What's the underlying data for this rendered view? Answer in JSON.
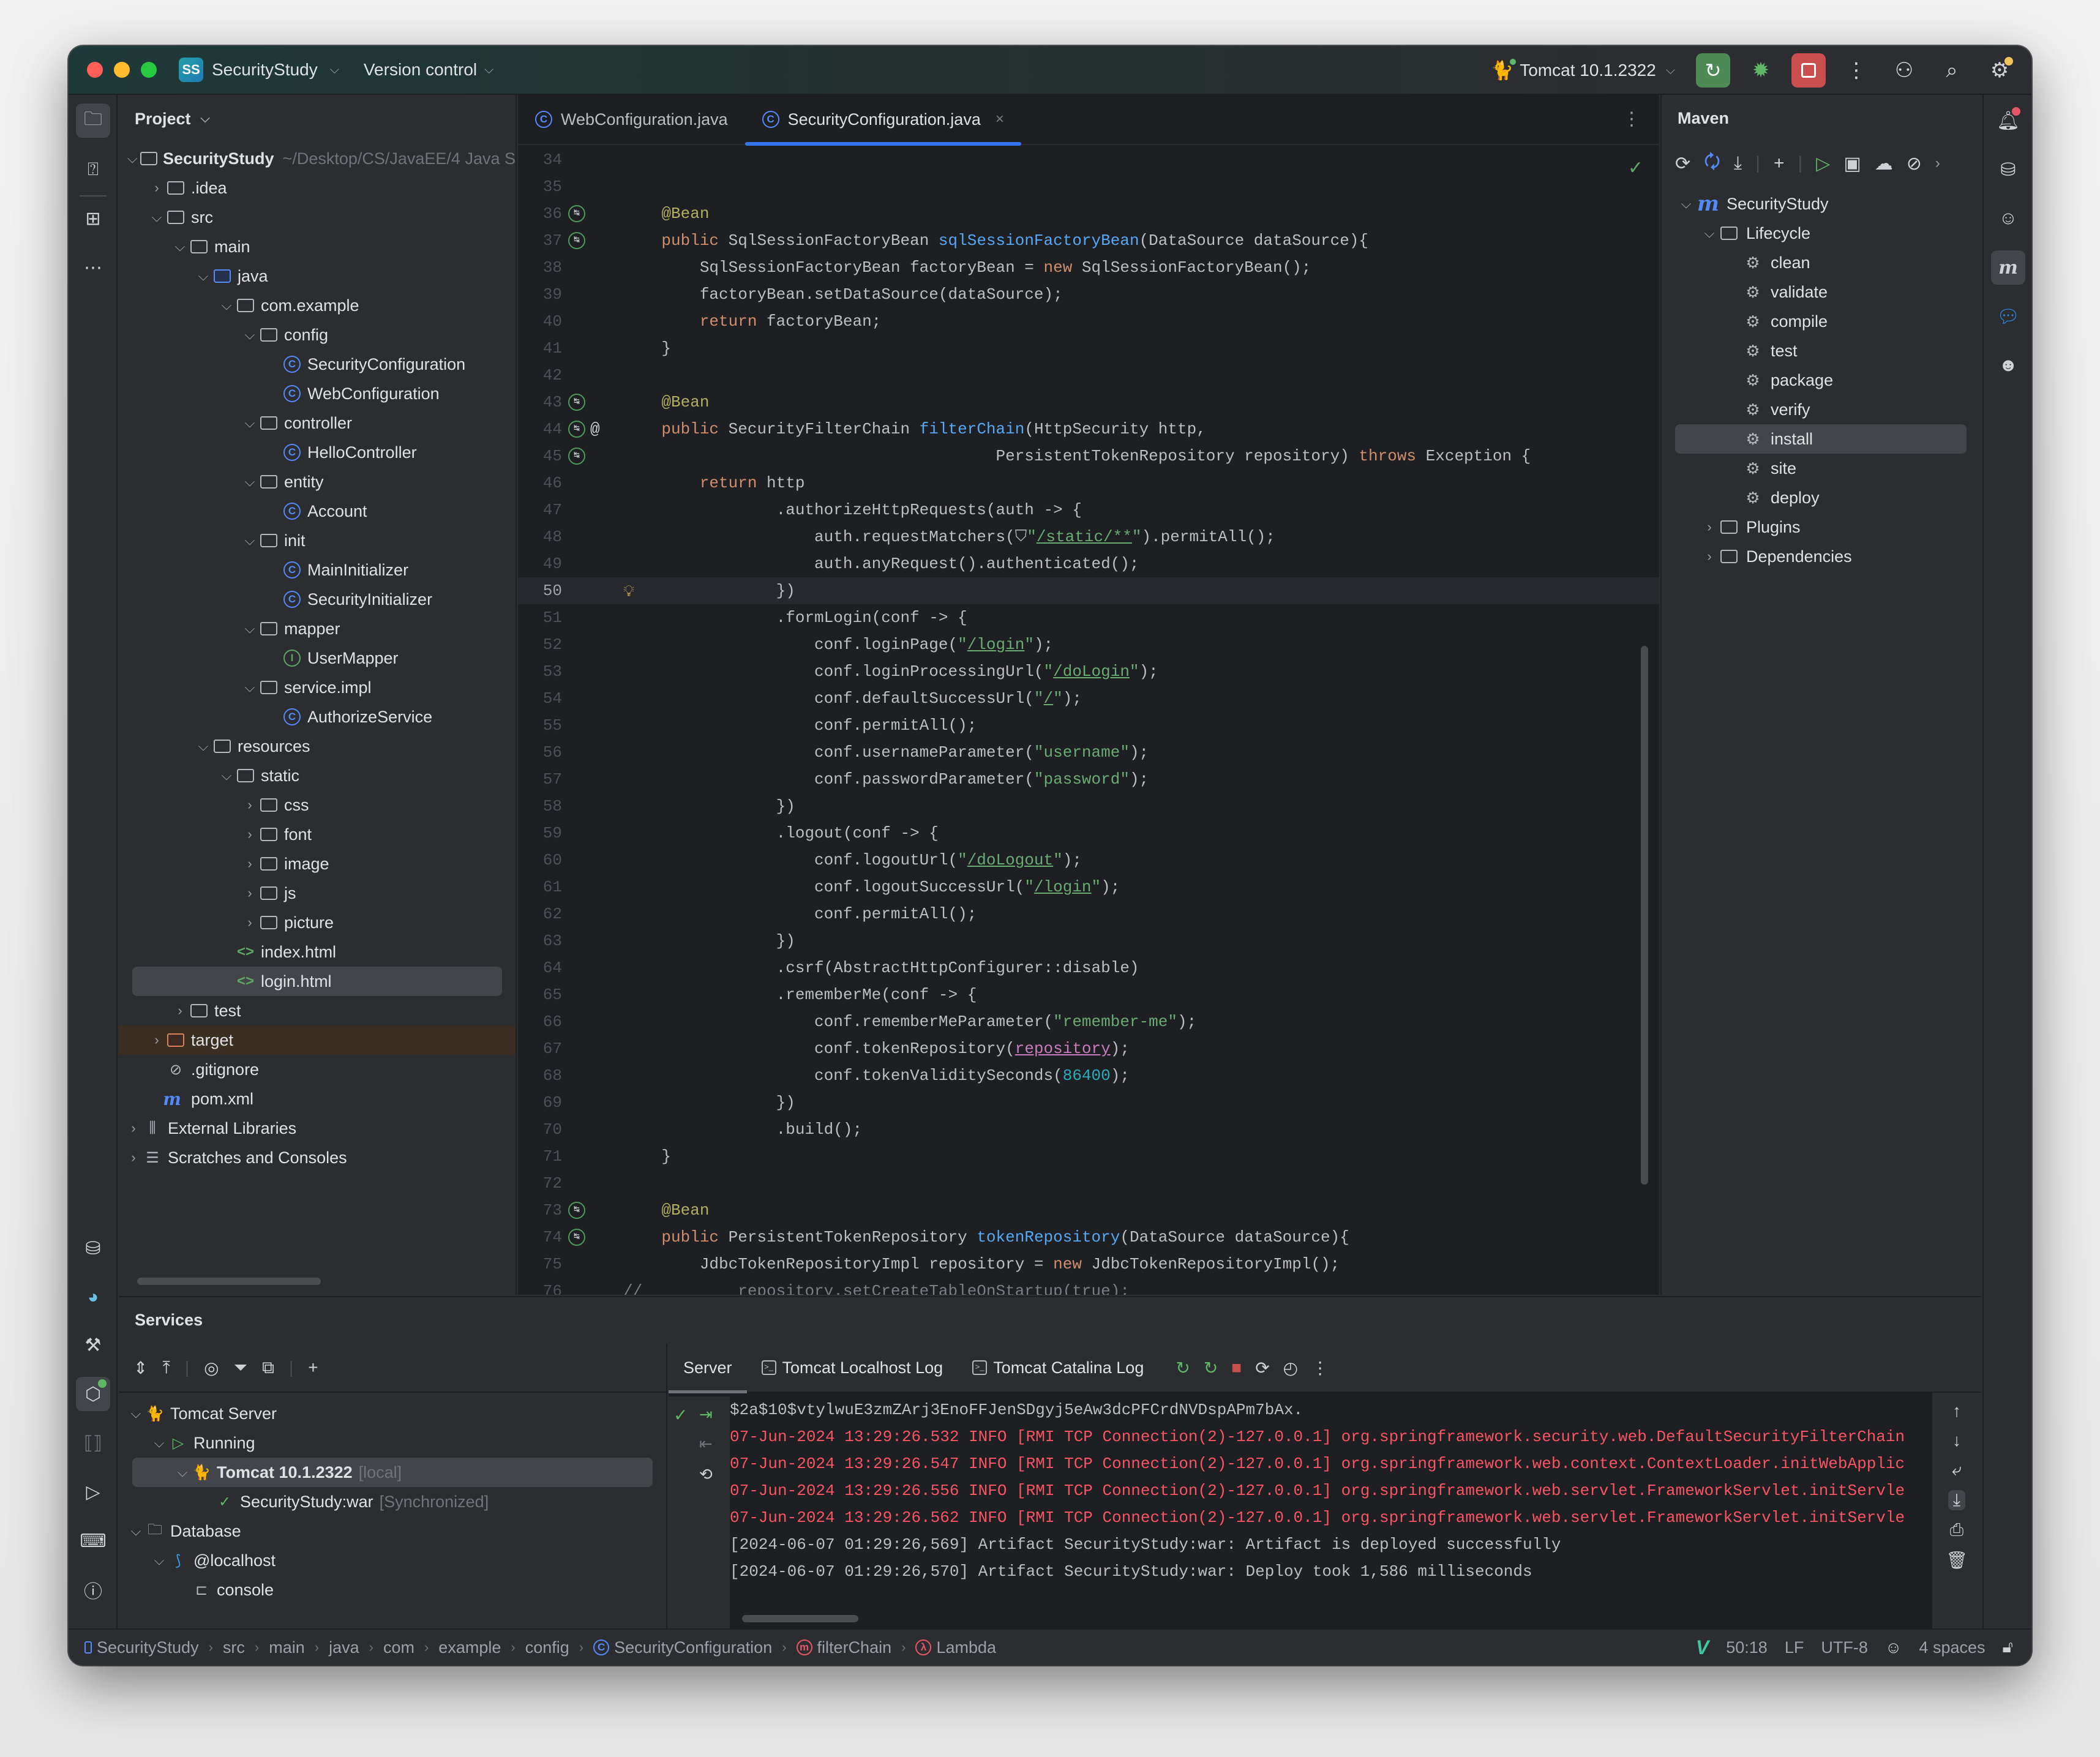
{
  "titlebar": {
    "project_badge": "SS",
    "project_name": "SecurityStudy",
    "vcs_label": "Version control",
    "run_config": "Tomcat 10.1.2322"
  },
  "project_panel": {
    "title": "Project",
    "tree": [
      {
        "label": "SecurityStudy",
        "suffix": "~/Desktop/CS/JavaEE/4 Java S",
        "depth": 0,
        "type": "module",
        "expanded": true,
        "bold": true
      },
      {
        "label": ".idea",
        "depth": 1,
        "type": "folder",
        "expanded": false
      },
      {
        "label": "src",
        "depth": 1,
        "type": "folder",
        "expanded": true
      },
      {
        "label": "main",
        "depth": 2,
        "type": "folder",
        "expanded": true
      },
      {
        "label": "java",
        "depth": 3,
        "type": "source-folder",
        "expanded": true
      },
      {
        "label": "com.example",
        "depth": 4,
        "type": "package",
        "expanded": true
      },
      {
        "label": "config",
        "depth": 5,
        "type": "package",
        "expanded": true
      },
      {
        "label": "SecurityConfiguration",
        "depth": 6,
        "type": "class"
      },
      {
        "label": "WebConfiguration",
        "depth": 6,
        "type": "class"
      },
      {
        "label": "controller",
        "depth": 5,
        "type": "package",
        "expanded": true
      },
      {
        "label": "HelloController",
        "depth": 6,
        "type": "class"
      },
      {
        "label": "entity",
        "depth": 5,
        "type": "package",
        "expanded": true
      },
      {
        "label": "Account",
        "depth": 6,
        "type": "class"
      },
      {
        "label": "init",
        "depth": 5,
        "type": "package",
        "expanded": true
      },
      {
        "label": "MainInitializer",
        "depth": 6,
        "type": "class"
      },
      {
        "label": "SecurityInitializer",
        "depth": 6,
        "type": "class"
      },
      {
        "label": "mapper",
        "depth": 5,
        "type": "package",
        "expanded": true
      },
      {
        "label": "UserMapper",
        "depth": 6,
        "type": "interface"
      },
      {
        "label": "service.impl",
        "depth": 5,
        "type": "package",
        "expanded": true
      },
      {
        "label": "AuthorizeService",
        "depth": 6,
        "type": "class"
      },
      {
        "label": "resources",
        "depth": 3,
        "type": "resources-folder",
        "expanded": true
      },
      {
        "label": "static",
        "depth": 4,
        "type": "folder",
        "expanded": true
      },
      {
        "label": "css",
        "depth": 5,
        "type": "folder",
        "expanded": false
      },
      {
        "label": "font",
        "depth": 5,
        "type": "folder",
        "expanded": false
      },
      {
        "label": "image",
        "depth": 5,
        "type": "folder",
        "expanded": false
      },
      {
        "label": "js",
        "depth": 5,
        "type": "folder",
        "expanded": false
      },
      {
        "label": "picture",
        "depth": 5,
        "type": "folder",
        "expanded": false
      },
      {
        "label": "index.html",
        "depth": 4,
        "type": "html"
      },
      {
        "label": "login.html",
        "depth": 4,
        "type": "html",
        "selected": true
      },
      {
        "label": "test",
        "depth": 2,
        "type": "folder",
        "expanded": false
      },
      {
        "label": "target",
        "depth": 1,
        "type": "excluded-folder",
        "expanded": false
      },
      {
        "label": ".gitignore",
        "depth": 1,
        "type": "ignore"
      },
      {
        "label": "pom.xml",
        "depth": 1,
        "type": "maven"
      },
      {
        "label": "External Libraries",
        "depth": 0,
        "type": "libraries",
        "expanded": false
      },
      {
        "label": "Scratches and Consoles",
        "depth": 0,
        "type": "scratches",
        "expanded": false
      }
    ]
  },
  "editor": {
    "tabs": [
      {
        "label": "WebConfiguration.java",
        "active": false
      },
      {
        "label": "SecurityConfiguration.java",
        "active": true
      }
    ],
    "current_line": 50,
    "lines": [
      {
        "n": 34,
        "html": ""
      },
      {
        "n": 35,
        "html": ""
      },
      {
        "n": 36,
        "html": "    <span class='ann'>@Bean</span>",
        "gutter": "bean"
      },
      {
        "n": 37,
        "html": "    <span class='kw'>public</span> SqlSessionFactoryBean <span class='fn'>sqlSessionFactoryBean</span>(DataSource dataSource){",
        "gutter": "bean"
      },
      {
        "n": 38,
        "html": "        SqlSessionFactoryBean factoryBean = <span class='kw'>new</span> SqlSessionFactoryBean();"
      },
      {
        "n": 39,
        "html": "        factoryBean.setDataSource(dataSource);"
      },
      {
        "n": 40,
        "html": "        <span class='kw'>return</span> factoryBean;"
      },
      {
        "n": 41,
        "html": "    }"
      },
      {
        "n": 42,
        "html": ""
      },
      {
        "n": 43,
        "html": "    <span class='ann'>@Bean</span>",
        "gutter": "bean"
      },
      {
        "n": 44,
        "html": "    <span class='kw'>public</span> SecurityFilterChain <span class='fn'>filterChain</span>(HttpSecurity http,",
        "gutter": "bean-at"
      },
      {
        "n": 45,
        "html": "                                       PersistentTokenRepository repository) <span class='kw'>throws</span> Exception {",
        "gutter": "bean"
      },
      {
        "n": 46,
        "html": "        <span class='kw'>return</span> http"
      },
      {
        "n": 47,
        "html": "                .authorizeHttpRequests(auth -> {"
      },
      {
        "n": 48,
        "html": "                    auth.requestMatchers(⛉<span class='str'>\"<span class='link'>/static/**</span>\"</span>).permitAll();"
      },
      {
        "n": 49,
        "html": "                    auth.anyRequest().authenticated();"
      },
      {
        "n": 50,
        "html": "                })",
        "gutter": "bulb"
      },
      {
        "n": 51,
        "html": "                .formLogin(conf -> {"
      },
      {
        "n": 52,
        "html": "                    conf.loginPage(<span class='str'>\"<span class='link'>/login</span>\"</span>);"
      },
      {
        "n": 53,
        "html": "                    conf.loginProcessingUrl(<span class='str'>\"<span class='link'>/doLogin</span>\"</span>);"
      },
      {
        "n": 54,
        "html": "                    conf.defaultSuccessUrl(<span class='str'>\"<span class='link'>/</span>\"</span>);"
      },
      {
        "n": 55,
        "html": "                    conf.permitAll();"
      },
      {
        "n": 56,
        "html": "                    conf.usernameParameter(<span class='str'>\"username\"</span>);"
      },
      {
        "n": 57,
        "html": "                    conf.passwordParameter(<span class='str'>\"password\"</span>);"
      },
      {
        "n": 58,
        "html": "                })"
      },
      {
        "n": 59,
        "html": "                .logout(conf -> {"
      },
      {
        "n": 60,
        "html": "                    conf.logoutUrl(<span class='str'>\"<span class='link'>/doLogout</span>\"</span>);"
      },
      {
        "n": 61,
        "html": "                    conf.logoutSuccessUrl(<span class='str'>\"<span class='link'>/login</span>\"</span>);"
      },
      {
        "n": 62,
        "html": "                    conf.permitAll();"
      },
      {
        "n": 63,
        "html": "                })"
      },
      {
        "n": 64,
        "html": "                .csrf(AbstractHttpConfigurer::disable)"
      },
      {
        "n": 65,
        "html": "                .rememberMe(conf -> {"
      },
      {
        "n": 66,
        "html": "                    conf.rememberMeParameter(<span class='str'>\"remember-me\"</span>);"
      },
      {
        "n": 67,
        "html": "                    conf.tokenRepository(<span class='param'>repository</span>);"
      },
      {
        "n": 68,
        "html": "                    conf.tokenValiditySeconds(<span class='num'>86400</span>);"
      },
      {
        "n": 69,
        "html": "                })"
      },
      {
        "n": 70,
        "html": "                .build();"
      },
      {
        "n": 71,
        "html": "    }"
      },
      {
        "n": 72,
        "html": ""
      },
      {
        "n": 73,
        "html": "    <span class='ann'>@Bean</span>",
        "gutter": "bean"
      },
      {
        "n": 74,
        "html": "    <span class='kw'>public</span> PersistentTokenRepository <span class='fn'>tokenRepository</span>(DataSource dataSource){",
        "gutter": "bean"
      },
      {
        "n": 75,
        "html": "        JdbcTokenRepositoryImpl repository = <span class='kw'>new</span> JdbcTokenRepositoryImpl();"
      },
      {
        "n": 76,
        "html": "<span class='cmt'>//          repository.setCreateTableOnStartup(true);</span>"
      }
    ]
  },
  "maven": {
    "title": "Maven",
    "project": "SecurityStudy",
    "lifecycle_label": "Lifecycle",
    "goals": [
      "clean",
      "validate",
      "compile",
      "test",
      "package",
      "verify",
      "install",
      "site",
      "deploy"
    ],
    "selected_goal": "install",
    "plugins_label": "Plugins",
    "dependencies_label": "Dependencies"
  },
  "services": {
    "title": "Services",
    "tree": [
      {
        "label": "Tomcat Server",
        "depth": 0,
        "type": "tomcat"
      },
      {
        "label": "Running",
        "depth": 1,
        "type": "running"
      },
      {
        "label": "Tomcat 10.1.2322",
        "suffix": "[local]",
        "depth": 2,
        "type": "tomcat-instance",
        "selected": true,
        "bold": true
      },
      {
        "label": "SecurityStudy:war",
        "suffix": "[Synchronized]",
        "depth": 3,
        "type": "artifact"
      },
      {
        "label": "Database",
        "depth": 0,
        "type": "folder"
      },
      {
        "label": "@localhost",
        "depth": 1,
        "type": "mysql"
      },
      {
        "label": "console",
        "depth": 2,
        "type": "console"
      }
    ],
    "tabs": [
      {
        "label": "Server",
        "active": true
      },
      {
        "label": "Tomcat Localhost Log",
        "active": false
      },
      {
        "label": "Tomcat Catalina Log",
        "active": false
      }
    ],
    "log": [
      {
        "text": "$2a$10$vtylwuE3zmZArj3EnoFFJenSDgyj5eAw3dcPFCrdNVDspAPm7bAx.",
        "level": "plain"
      },
      {
        "text": "07-Jun-2024 13:29:26.532 INFO [RMI TCP Connection(2)-127.0.0.1] org.springframework.security.web.DefaultSecurityFilterChain",
        "level": "info"
      },
      {
        "text": "07-Jun-2024 13:29:26.547 INFO [RMI TCP Connection(2)-127.0.0.1] org.springframework.web.context.ContextLoader.initWebApplic",
        "level": "info"
      },
      {
        "text": "07-Jun-2024 13:29:26.556 INFO [RMI TCP Connection(2)-127.0.0.1] org.springframework.web.servlet.FrameworkServlet.initServle",
        "level": "info"
      },
      {
        "text": "07-Jun-2024 13:29:26.562 INFO [RMI TCP Connection(2)-127.0.0.1] org.springframework.web.servlet.FrameworkServlet.initServle",
        "level": "info"
      },
      {
        "text": "[2024-06-07 01:29:26,569] Artifact SecurityStudy:war: Artifact is deployed successfully",
        "level": "plain"
      },
      {
        "text": "[2024-06-07 01:29:26,570] Artifact SecurityStudy:war: Deploy took 1,586 milliseconds",
        "level": "plain"
      }
    ]
  },
  "statusbar": {
    "breadcrumbs": [
      {
        "label": "SecurityStudy",
        "icon": "module"
      },
      {
        "label": "src"
      },
      {
        "label": "main"
      },
      {
        "label": "java"
      },
      {
        "label": "com"
      },
      {
        "label": "example"
      },
      {
        "label": "config"
      },
      {
        "label": "SecurityConfiguration",
        "icon": "class"
      },
      {
        "label": "filterChain",
        "icon": "method"
      },
      {
        "label": "Lambda",
        "icon": "lambda"
      }
    ],
    "position": "50:18",
    "line_separator": "LF",
    "encoding": "UTF-8",
    "indent": "4 spaces"
  },
  "colors": {
    "accent": "#3574f0",
    "run_green": "#4e8a55",
    "stop_red": "#c94f4f",
    "log_error": "#f75464"
  }
}
